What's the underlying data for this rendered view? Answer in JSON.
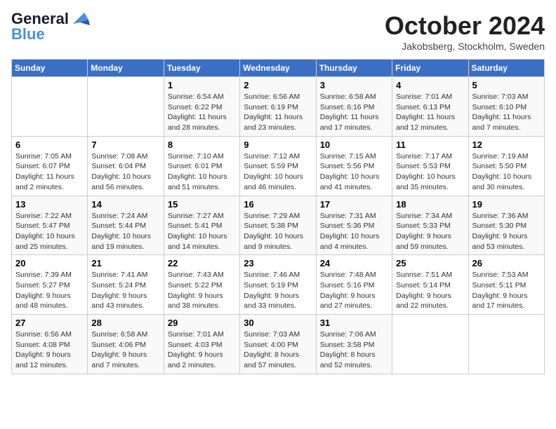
{
  "logo": {
    "line1": "General",
    "line2": "Blue"
  },
  "title": "October 2024",
  "location": "Jakobsberg, Stockholm, Sweden",
  "weekdays": [
    "Sunday",
    "Monday",
    "Tuesday",
    "Wednesday",
    "Thursday",
    "Friday",
    "Saturday"
  ],
  "weeks": [
    [
      {
        "day": "",
        "sunrise": "",
        "sunset": "",
        "daylight": ""
      },
      {
        "day": "",
        "sunrise": "",
        "sunset": "",
        "daylight": ""
      },
      {
        "day": "1",
        "sunrise": "Sunrise: 6:54 AM",
        "sunset": "Sunset: 6:22 PM",
        "daylight": "Daylight: 11 hours and 28 minutes."
      },
      {
        "day": "2",
        "sunrise": "Sunrise: 6:56 AM",
        "sunset": "Sunset: 6:19 PM",
        "daylight": "Daylight: 11 hours and 23 minutes."
      },
      {
        "day": "3",
        "sunrise": "Sunrise: 6:58 AM",
        "sunset": "Sunset: 6:16 PM",
        "daylight": "Daylight: 11 hours and 17 minutes."
      },
      {
        "day": "4",
        "sunrise": "Sunrise: 7:01 AM",
        "sunset": "Sunset: 6:13 PM",
        "daylight": "Daylight: 11 hours and 12 minutes."
      },
      {
        "day": "5",
        "sunrise": "Sunrise: 7:03 AM",
        "sunset": "Sunset: 6:10 PM",
        "daylight": "Daylight: 11 hours and 7 minutes."
      }
    ],
    [
      {
        "day": "6",
        "sunrise": "Sunrise: 7:05 AM",
        "sunset": "Sunset: 6:07 PM",
        "daylight": "Daylight: 11 hours and 2 minutes."
      },
      {
        "day": "7",
        "sunrise": "Sunrise: 7:08 AM",
        "sunset": "Sunset: 6:04 PM",
        "daylight": "Daylight: 10 hours and 56 minutes."
      },
      {
        "day": "8",
        "sunrise": "Sunrise: 7:10 AM",
        "sunset": "Sunset: 6:01 PM",
        "daylight": "Daylight: 10 hours and 51 minutes."
      },
      {
        "day": "9",
        "sunrise": "Sunrise: 7:12 AM",
        "sunset": "Sunset: 5:59 PM",
        "daylight": "Daylight: 10 hours and 46 minutes."
      },
      {
        "day": "10",
        "sunrise": "Sunrise: 7:15 AM",
        "sunset": "Sunset: 5:56 PM",
        "daylight": "Daylight: 10 hours and 41 minutes."
      },
      {
        "day": "11",
        "sunrise": "Sunrise: 7:17 AM",
        "sunset": "Sunset: 5:53 PM",
        "daylight": "Daylight: 10 hours and 35 minutes."
      },
      {
        "day": "12",
        "sunrise": "Sunrise: 7:19 AM",
        "sunset": "Sunset: 5:50 PM",
        "daylight": "Daylight: 10 hours and 30 minutes."
      }
    ],
    [
      {
        "day": "13",
        "sunrise": "Sunrise: 7:22 AM",
        "sunset": "Sunset: 5:47 PM",
        "daylight": "Daylight: 10 hours and 25 minutes."
      },
      {
        "day": "14",
        "sunrise": "Sunrise: 7:24 AM",
        "sunset": "Sunset: 5:44 PM",
        "daylight": "Daylight: 10 hours and 19 minutes."
      },
      {
        "day": "15",
        "sunrise": "Sunrise: 7:27 AM",
        "sunset": "Sunset: 5:41 PM",
        "daylight": "Daylight: 10 hours and 14 minutes."
      },
      {
        "day": "16",
        "sunrise": "Sunrise: 7:29 AM",
        "sunset": "Sunset: 5:38 PM",
        "daylight": "Daylight: 10 hours and 9 minutes."
      },
      {
        "day": "17",
        "sunrise": "Sunrise: 7:31 AM",
        "sunset": "Sunset: 5:36 PM",
        "daylight": "Daylight: 10 hours and 4 minutes."
      },
      {
        "day": "18",
        "sunrise": "Sunrise: 7:34 AM",
        "sunset": "Sunset: 5:33 PM",
        "daylight": "Daylight: 9 hours and 59 minutes."
      },
      {
        "day": "19",
        "sunrise": "Sunrise: 7:36 AM",
        "sunset": "Sunset: 5:30 PM",
        "daylight": "Daylight: 9 hours and 53 minutes."
      }
    ],
    [
      {
        "day": "20",
        "sunrise": "Sunrise: 7:39 AM",
        "sunset": "Sunset: 5:27 PM",
        "daylight": "Daylight: 9 hours and 48 minutes."
      },
      {
        "day": "21",
        "sunrise": "Sunrise: 7:41 AM",
        "sunset": "Sunset: 5:24 PM",
        "daylight": "Daylight: 9 hours and 43 minutes."
      },
      {
        "day": "22",
        "sunrise": "Sunrise: 7:43 AM",
        "sunset": "Sunset: 5:22 PM",
        "daylight": "Daylight: 9 hours and 38 minutes."
      },
      {
        "day": "23",
        "sunrise": "Sunrise: 7:46 AM",
        "sunset": "Sunset: 5:19 PM",
        "daylight": "Daylight: 9 hours and 33 minutes."
      },
      {
        "day": "24",
        "sunrise": "Sunrise: 7:48 AM",
        "sunset": "Sunset: 5:16 PM",
        "daylight": "Daylight: 9 hours and 27 minutes."
      },
      {
        "day": "25",
        "sunrise": "Sunrise: 7:51 AM",
        "sunset": "Sunset: 5:14 PM",
        "daylight": "Daylight: 9 hours and 22 minutes."
      },
      {
        "day": "26",
        "sunrise": "Sunrise: 7:53 AM",
        "sunset": "Sunset: 5:11 PM",
        "daylight": "Daylight: 9 hours and 17 minutes."
      }
    ],
    [
      {
        "day": "27",
        "sunrise": "Sunrise: 6:56 AM",
        "sunset": "Sunset: 4:08 PM",
        "daylight": "Daylight: 9 hours and 12 minutes."
      },
      {
        "day": "28",
        "sunrise": "Sunrise: 6:58 AM",
        "sunset": "Sunset: 4:06 PM",
        "daylight": "Daylight: 9 hours and 7 minutes."
      },
      {
        "day": "29",
        "sunrise": "Sunrise: 7:01 AM",
        "sunset": "Sunset: 4:03 PM",
        "daylight": "Daylight: 9 hours and 2 minutes."
      },
      {
        "day": "30",
        "sunrise": "Sunrise: 7:03 AM",
        "sunset": "Sunset: 4:00 PM",
        "daylight": "Daylight: 8 hours and 57 minutes."
      },
      {
        "day": "31",
        "sunrise": "Sunrise: 7:06 AM",
        "sunset": "Sunset: 3:58 PM",
        "daylight": "Daylight: 8 hours and 52 minutes."
      },
      {
        "day": "",
        "sunrise": "",
        "sunset": "",
        "daylight": ""
      },
      {
        "day": "",
        "sunrise": "",
        "sunset": "",
        "daylight": ""
      }
    ]
  ]
}
